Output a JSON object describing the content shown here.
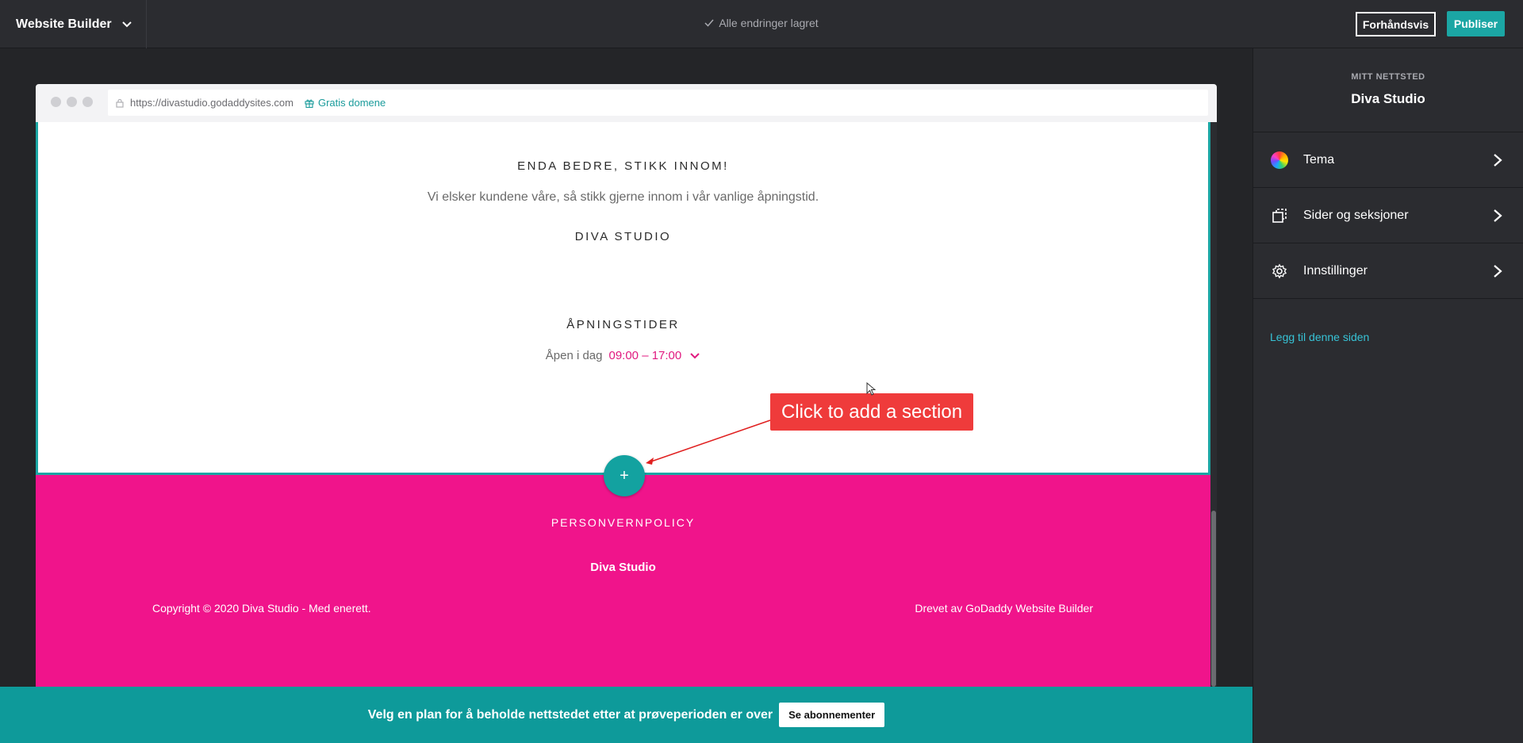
{
  "topbar": {
    "brand": "Website Builder",
    "saved_status": "Alle endringer lagret",
    "preview_label": "Forhåndsvis",
    "publish_label": "Publiser"
  },
  "browser": {
    "url": "https://divastudio.godaddysites.com",
    "domain_link": "Gratis domene"
  },
  "content": {
    "heading1": "ENDA BEDRE, STIKK INNOM!",
    "text1": "Vi elsker kundene våre, så stikk gjerne innom i vår vanlige åpningstid.",
    "heading2": "DIVA STUDIO",
    "heading3": "ÅPNINGSTIDER",
    "open_label": "Åpen i dag",
    "open_time": "09:00 – 17:00",
    "add_button": "+"
  },
  "footer": {
    "privacy": "PERSONVERNPOLICY",
    "site_name": "Diva Studio",
    "copyright": "Copyright © 2020 Diva Studio - Med enerett.",
    "powered_by": "Drevet av GoDaddy Website Builder"
  },
  "panel": {
    "kicker": "MITT NETTSTED",
    "title": "Diva Studio",
    "items": [
      {
        "label": "Tema",
        "icon": "color-wheel-icon"
      },
      {
        "label": "Sider og seksjoner",
        "icon": "pages-icon"
      },
      {
        "label": "Innstillinger",
        "icon": "gear-icon"
      }
    ],
    "add_link": "Legg til denne siden"
  },
  "annotation": {
    "label": "Click to add a section",
    "color": "#ef3b3b"
  },
  "banner": {
    "text": "Velg en plan for å beholde nettstedet etter at prøveperioden er over",
    "button": "Se abonnementer"
  },
  "colors": {
    "accent": "#1ba6a4",
    "footer_pink": "#f0148b",
    "link": "#37c3d6"
  }
}
